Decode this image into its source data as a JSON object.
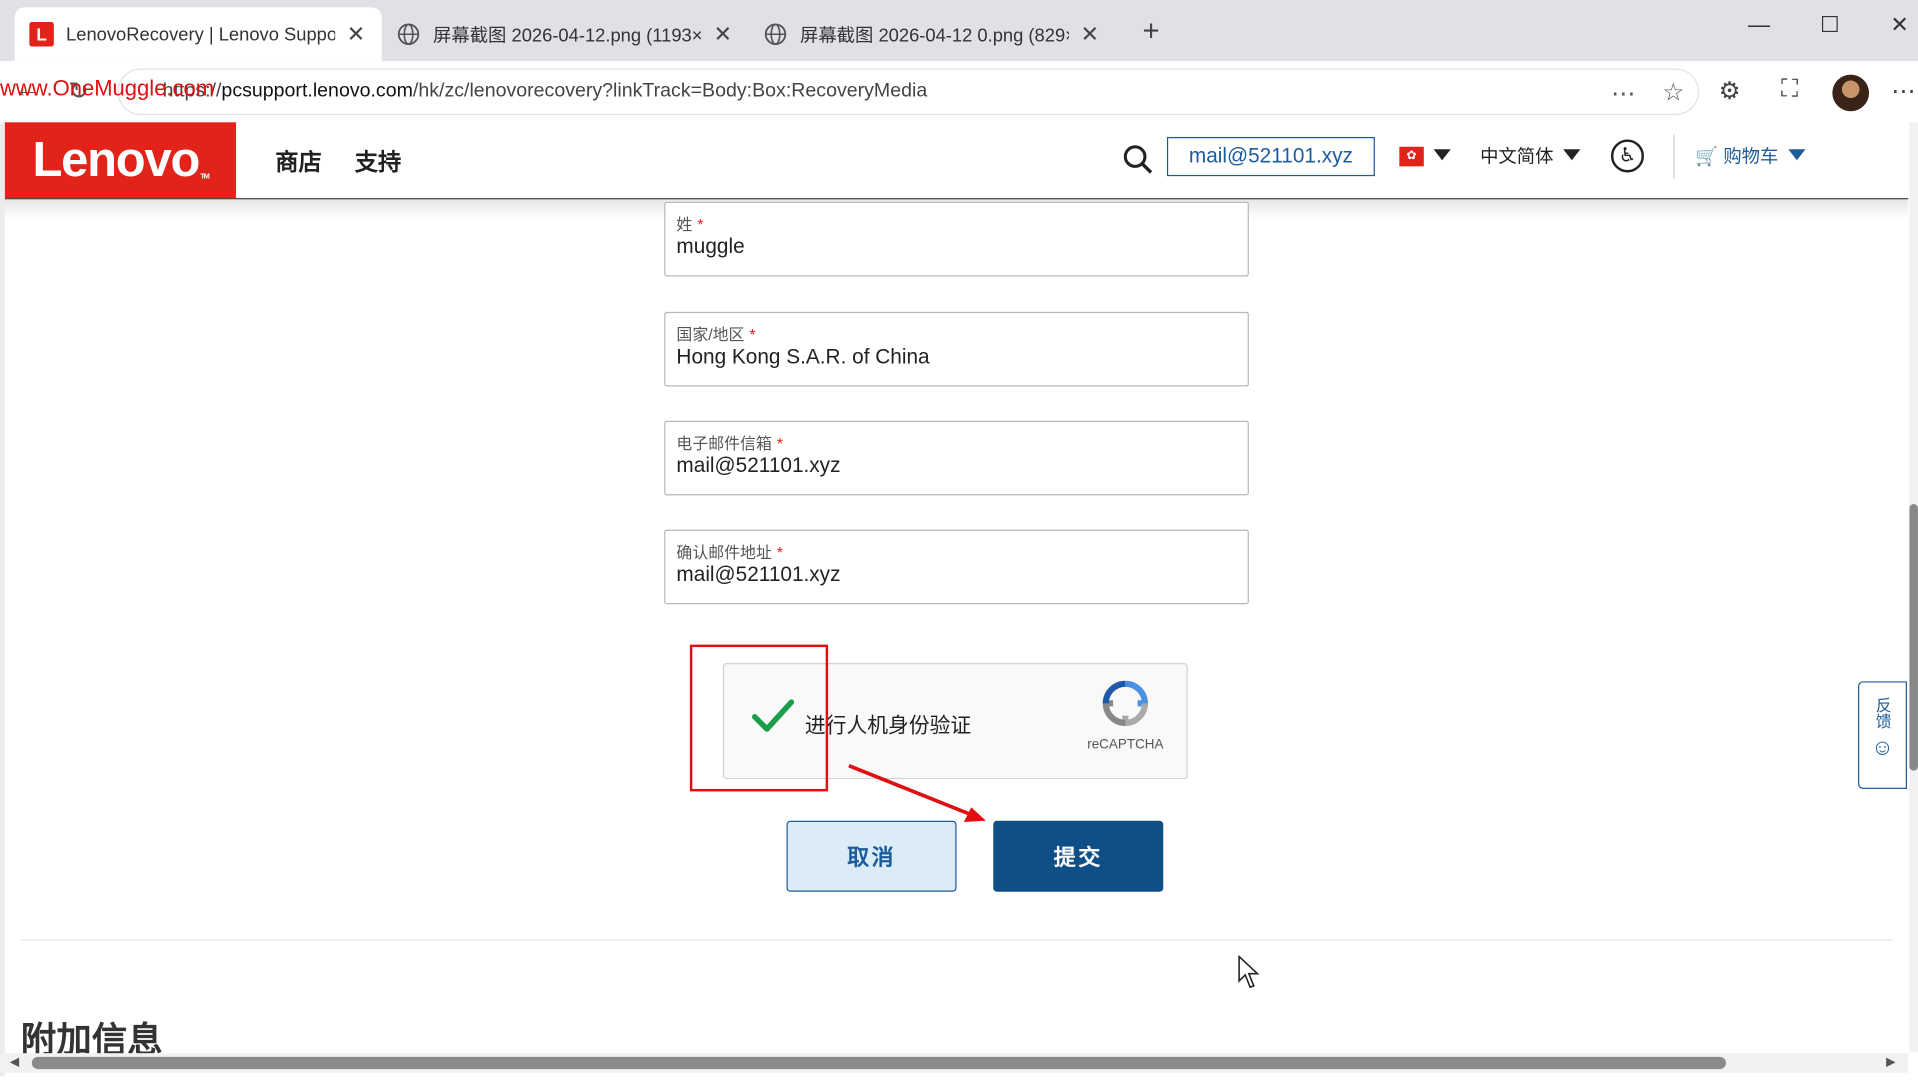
{
  "browser": {
    "tabs": [
      {
        "title": "LenovoRecovery | Lenovo Support",
        "active": true,
        "icon": "lenovo-favicon"
      },
      {
        "title": "屏幕截图 2026-04-12.png (1193×9",
        "active": false,
        "icon": "globe-icon"
      },
      {
        "title": "屏幕截图 2026-04-12 0.png (829×",
        "active": false,
        "icon": "globe-icon"
      }
    ],
    "url_scheme": "https://",
    "url_host": "pcsupport.lenovo.com",
    "url_path": "/hk/zc/lenovorecovery?linkTrack=Body:Box:RecoveryMedia",
    "watermark": "www.OneMuggle.com"
  },
  "header": {
    "logo": "Lenovo",
    "logo_tm": "TM",
    "nav": [
      "商店",
      "支持"
    ],
    "user": "mail@521101.xyz",
    "language": "中文简体",
    "cart": "购物车"
  },
  "form": {
    "last_name": {
      "label": "姓",
      "required": "*",
      "value": "muggle"
    },
    "country": {
      "label": "国家/地区",
      "required": "*",
      "value": "Hong Kong S.A.R. of China"
    },
    "email": {
      "label": "电子邮件信箱",
      "required": "*",
      "value": "mail@521101.xyz"
    },
    "confirm_email": {
      "label": "确认邮件地址",
      "required": "*",
      "value": "mail@521101.xyz"
    },
    "captcha": {
      "text": "进行人机身份验证",
      "brand": "reCAPTCHA",
      "checked": true
    },
    "cancel": "取消",
    "submit": "提交"
  },
  "section": {
    "title": "附加信息"
  },
  "feedback": {
    "label": "反馈"
  },
  "colors": {
    "brand_red": "#e2231a",
    "link_blue": "#1c5c9a",
    "submit_blue": "#0f4f87",
    "annotation_red": "#e01010"
  }
}
